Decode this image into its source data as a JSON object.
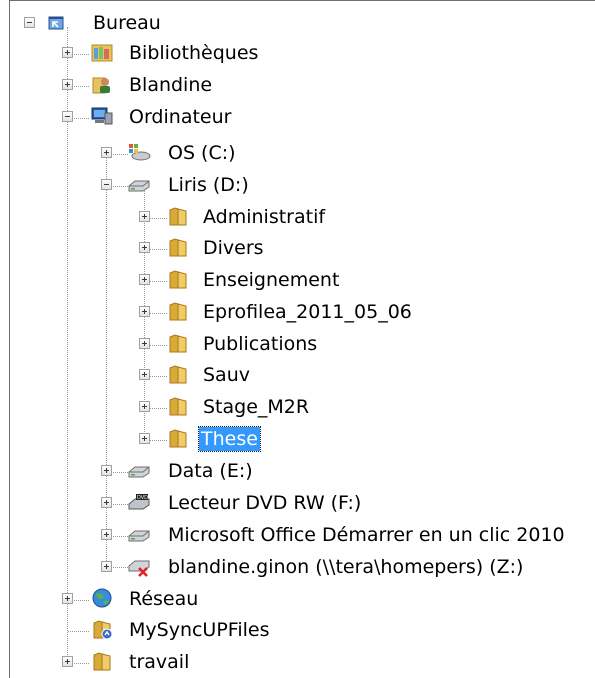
{
  "tree": {
    "root": {
      "label": "Bureau",
      "icon": "desktop-icon",
      "state": "expanded"
    },
    "bibliotheques": {
      "label": "Bibliothèques",
      "icon": "libraries-icon",
      "state": "collapsed"
    },
    "blandine": {
      "label": "Blandine",
      "icon": "user-folder-icon",
      "state": "collapsed"
    },
    "ordinateur": {
      "label": "Ordinateur",
      "icon": "computer-icon",
      "state": "expanded"
    },
    "drive_c": {
      "label": "OS (C:)",
      "icon": "windows-drive-icon",
      "state": "collapsed"
    },
    "drive_d": {
      "label": "Liris (D:)",
      "icon": "hard-drive-icon",
      "state": "expanded"
    },
    "folders_d": [
      {
        "label": "Administratif",
        "icon": "folder-icon",
        "state": "collapsed"
      },
      {
        "label": "Divers",
        "icon": "folder-icon",
        "state": "collapsed"
      },
      {
        "label": "Enseignement",
        "icon": "folder-icon",
        "state": "collapsed"
      },
      {
        "label": "Eprofilea_2011_05_06",
        "icon": "folder-icon",
        "state": "collapsed"
      },
      {
        "label": "Publications",
        "icon": "folder-icon",
        "state": "collapsed"
      },
      {
        "label": "Sauv",
        "icon": "folder-icon",
        "state": "collapsed"
      },
      {
        "label": "Stage_M2R",
        "icon": "folder-icon",
        "state": "collapsed"
      },
      {
        "label": "These",
        "icon": "folder-icon",
        "state": "collapsed",
        "selected": true
      }
    ],
    "drive_e": {
      "label": "Data (E:)",
      "icon": "hard-drive-icon",
      "state": "collapsed"
    },
    "drive_f": {
      "label": "Lecteur DVD RW (F:)",
      "icon": "dvd-drive-icon",
      "state": "collapsed"
    },
    "drive_office": {
      "label": "Microsoft Office Démarrer en un clic 2010",
      "icon": "hard-drive-icon",
      "state": "collapsed"
    },
    "drive_z": {
      "label": "blandine.ginon (\\\\tera\\homepers) (Z:)",
      "icon": "disconnected-network-drive-icon",
      "state": "collapsed"
    },
    "reseau": {
      "label": "Réseau",
      "icon": "network-icon",
      "state": "collapsed"
    },
    "mysync": {
      "label": "MySyncUPFiles",
      "icon": "folder-shortcut-icon"
    },
    "travail": {
      "label": "travail",
      "icon": "folder-icon",
      "state": "collapsed"
    }
  },
  "colors": {
    "selection": "#3399ff",
    "folder": "#e8c25a",
    "tree_lines": "#9a9a9a"
  }
}
